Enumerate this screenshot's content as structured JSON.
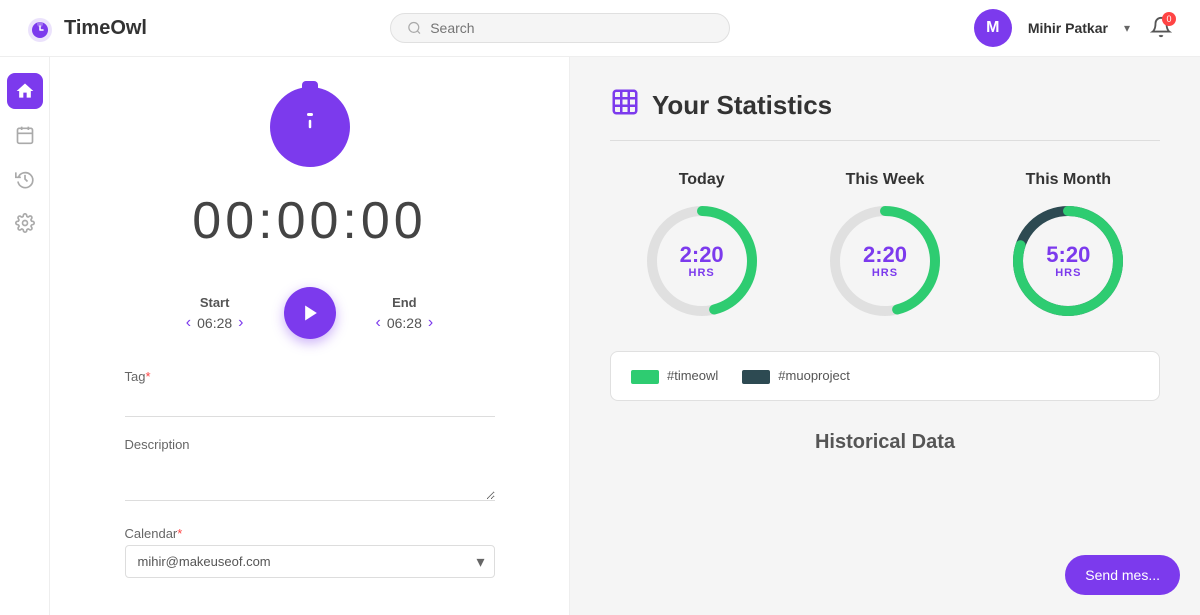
{
  "header": {
    "logo_text": "TimeOwl",
    "search_placeholder": "Search",
    "user_avatar_initial": "M",
    "user_name": "Mihir Patkar",
    "notification_count": "0"
  },
  "sidebar": {
    "items": [
      {
        "name": "home",
        "icon": "home",
        "active": true
      },
      {
        "name": "calendar",
        "icon": "calendar",
        "active": false
      },
      {
        "name": "history",
        "icon": "history",
        "active": false
      },
      {
        "name": "settings",
        "icon": "settings",
        "active": false
      }
    ]
  },
  "timer": {
    "display": "00:00:00",
    "start_label": "Start",
    "start_time": "06:28",
    "end_label": "End",
    "end_time": "06:28",
    "tag_label": "Tag",
    "tag_required": "*",
    "description_label": "Description",
    "calendar_label": "Calendar",
    "calendar_required": "*",
    "calendar_value": "mihir@makeuseof.com"
  },
  "statistics": {
    "title": "Your Statistics",
    "periods": [
      {
        "label": "Today",
        "value": "2:20",
        "unit": "HRS",
        "percent": 46,
        "color": "#2ecc71",
        "bg_color": "#e0faf0",
        "track_color": "#e0e0e0"
      },
      {
        "label": "This Week",
        "value": "2:20",
        "unit": "HRS",
        "percent": 46,
        "color": "#2ecc71",
        "bg_color": "#e0faf0",
        "track_color": "#e0e0e0"
      },
      {
        "label": "This Month",
        "value": "5:20",
        "unit": "HRS",
        "percent": 80,
        "color": "#2ecc71",
        "bg_color": "#e0faf0",
        "track_color": "#2d4a52"
      }
    ],
    "legend": [
      {
        "color": "#2ecc71",
        "text": "#timeowl"
      },
      {
        "color": "#2d4a52",
        "text": "#muoproject"
      }
    ],
    "historical_title": "Historical Data"
  },
  "chat": {
    "label": "Send mes..."
  }
}
